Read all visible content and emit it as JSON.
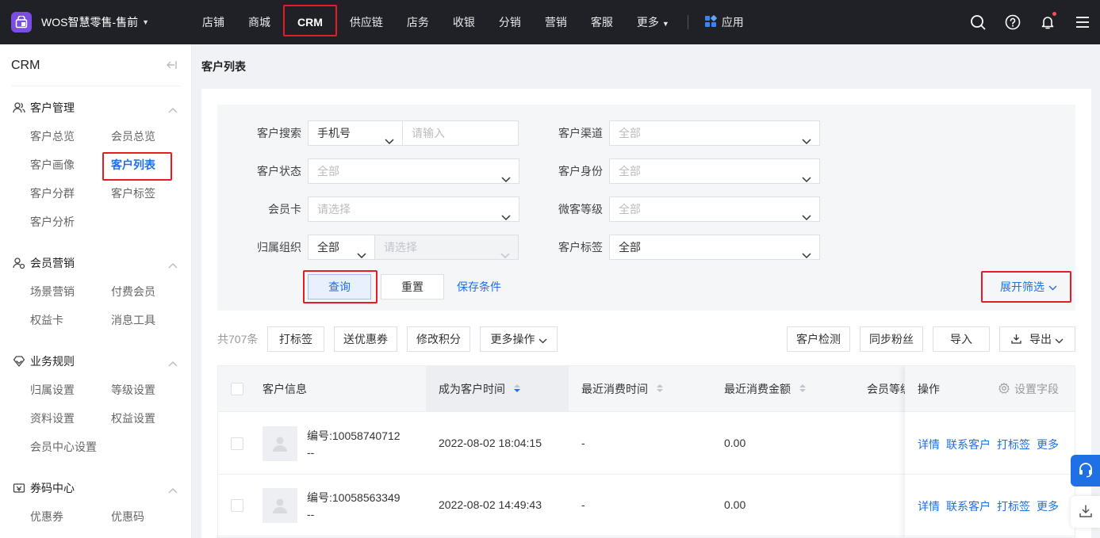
{
  "header": {
    "brand": "WOS智慧零售-售前",
    "nav": [
      "店铺",
      "商城",
      "CRM",
      "供应链",
      "店务",
      "收银",
      "分销",
      "营销",
      "客服",
      "更多"
    ],
    "apps": "应用"
  },
  "sidebar": {
    "title": "CRM",
    "groups": [
      {
        "label": "客户管理",
        "items": [
          "客户总览",
          "会员总览",
          "客户画像",
          "客户列表",
          "客户分群",
          "客户标签",
          "客户分析"
        ]
      },
      {
        "label": "会员营销",
        "items": [
          "场景营销",
          "付费会员",
          "权益卡",
          "消息工具"
        ]
      },
      {
        "label": "业务规则",
        "items": [
          "归属设置",
          "等级设置",
          "资料设置",
          "权益设置",
          "会员中心设置"
        ]
      },
      {
        "label": "券码中心",
        "items": [
          "优惠券",
          "优惠码"
        ]
      }
    ]
  },
  "page": {
    "title": "客户列表"
  },
  "filters": {
    "customer_search": {
      "label": "客户搜索",
      "type_value": "手机号",
      "placeholder": "请输入"
    },
    "customer_status": {
      "label": "客户状态",
      "value": "全部"
    },
    "member_card": {
      "label": "会员卡",
      "value": "请选择"
    },
    "org": {
      "label": "归属组织",
      "value": "全部",
      "sub_value": "请选择"
    },
    "channel": {
      "label": "客户渠道",
      "value": "全部"
    },
    "identity": {
      "label": "客户身份",
      "value": "全部"
    },
    "wk_level": {
      "label": "微客等级",
      "value": "全部"
    },
    "tag": {
      "label": "客户标签",
      "value": "全部"
    },
    "query": "查询",
    "reset": "重置",
    "save": "保存条件",
    "expand": "展开筛选"
  },
  "toolbar": {
    "total": "共707条",
    "tag": "打标签",
    "coupon": "送优惠券",
    "points": "修改积分",
    "more": "更多操作",
    "detect": "客户检测",
    "sync": "同步粉丝",
    "import": "导入",
    "export": "导出"
  },
  "table": {
    "columns": [
      "客户信息",
      "成为客户时间",
      "最近消费时间",
      "最近消费金额",
      "会员等级",
      "操作",
      "设置字段"
    ],
    "rows": [
      {
        "id": "编号:10058740712",
        "name": "--",
        "created": "2022-08-02 18:04:15",
        "last_time": "-",
        "amount": "0.00"
      },
      {
        "id": "编号:10058563349",
        "name": "--",
        "created": "2022-08-02 14:49:43",
        "last_time": "-",
        "amount": "0.00"
      }
    ],
    "actions": [
      "详情",
      "联系客户",
      "打标签",
      "更多"
    ]
  },
  "colors": {
    "accent": "#1f6fe5",
    "topbar": "#1f2127",
    "highlight": "#e51c23"
  }
}
